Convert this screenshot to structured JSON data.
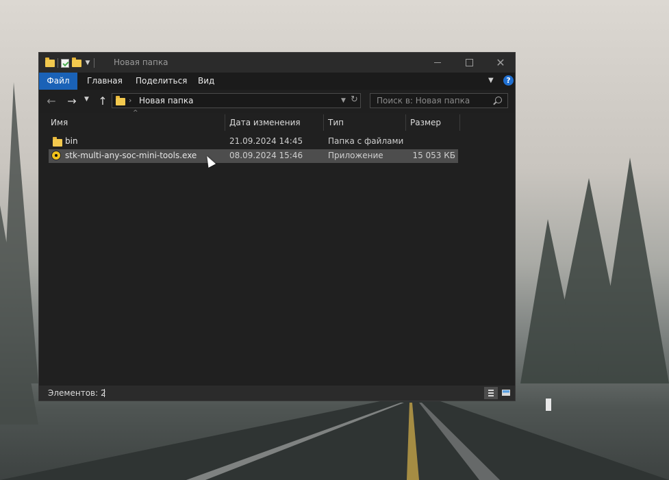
{
  "window": {
    "title": "Новая папка"
  },
  "ribbon": {
    "tabs": [
      {
        "label": "Файл"
      },
      {
        "label": "Главная"
      },
      {
        "label": "Поделиться"
      },
      {
        "label": "Вид"
      }
    ],
    "help": "?"
  },
  "navigation": {
    "back_icon": "←",
    "forward_icon": "→",
    "up_icon": "↑",
    "address": "Новая папка",
    "search_placeholder": "Поиск в: Новая папка"
  },
  "columns": [
    {
      "label": "Имя"
    },
    {
      "label": "Дата изменения"
    },
    {
      "label": "Тип"
    },
    {
      "label": "Размер"
    }
  ],
  "files": [
    {
      "name": "bin",
      "date": "21.09.2024 14:45",
      "type": "Папка с файлами",
      "size": "",
      "icon": "folder-icon"
    },
    {
      "name": "stk-multi-any-soc-mini-tools.exe",
      "date": "08.09.2024 15:46",
      "type": "Приложение",
      "size": "15 053 КБ",
      "icon": "radiation-app-icon",
      "selected": true
    }
  ],
  "status": {
    "items_text": "Элементов: 2"
  },
  "colors": {
    "accent": "#1a62b7",
    "window_bg": "#202020",
    "selection": "#4d4d4d"
  }
}
